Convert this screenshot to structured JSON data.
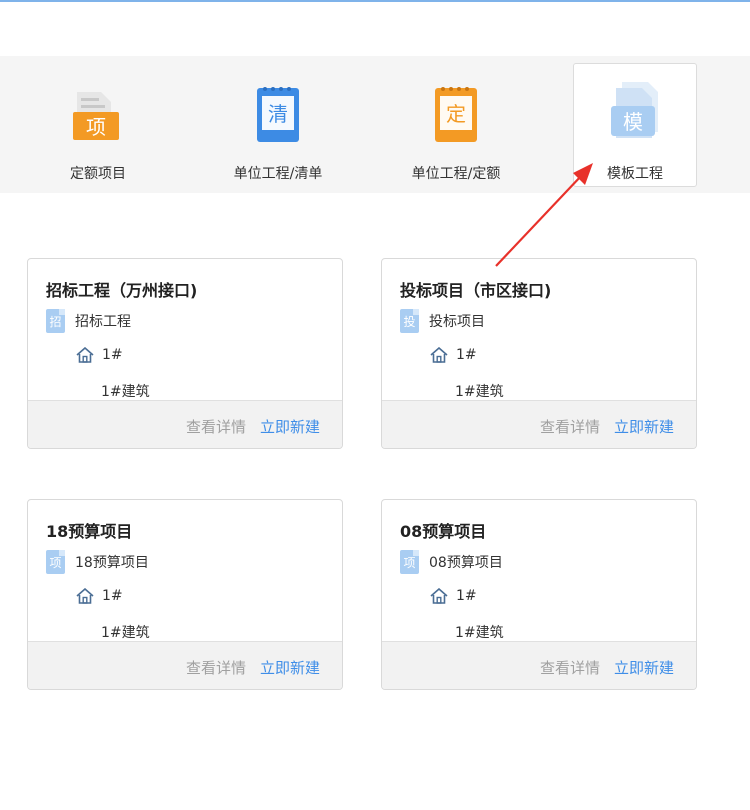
{
  "toolbar": {
    "items": [
      {
        "label": "定额项目",
        "icon_char": "项",
        "icon_color": "#f39a24"
      },
      {
        "label": "单位工程/清单",
        "icon_char": "清",
        "icon_color": "#3d8be4"
      },
      {
        "label": "单位工程/定额",
        "icon_char": "定",
        "icon_color": "#f39a24"
      },
      {
        "label": "模板工程",
        "icon_char": "模",
        "icon_color": "#a9cdf2"
      }
    ]
  },
  "cards": [
    {
      "title": "招标工程（万州接口)",
      "badge": "招",
      "project": "招标工程",
      "unit": "1#",
      "building": "1#建筑",
      "detail": "查看详情",
      "create": "立即新建"
    },
    {
      "title": "投标项目（市区接口)",
      "badge": "投",
      "project": "投标项目",
      "unit": "1#",
      "building": "1#建筑",
      "detail": "查看详情",
      "create": "立即新建"
    },
    {
      "title": "18预算项目",
      "badge": "项",
      "project": "18预算项目",
      "unit": "1#",
      "building": "1#建筑",
      "detail": "查看详情",
      "create": "立即新建"
    },
    {
      "title": "08预算项目",
      "badge": "项",
      "project": "08预算项目",
      "unit": "1#",
      "building": "1#建筑",
      "detail": "查看详情",
      "create": "立即新建"
    }
  ],
  "colors": {
    "accent": "#3f8ee8",
    "arrow": "#e8312a",
    "orange": "#f39a24",
    "blue": "#3d8be4"
  }
}
